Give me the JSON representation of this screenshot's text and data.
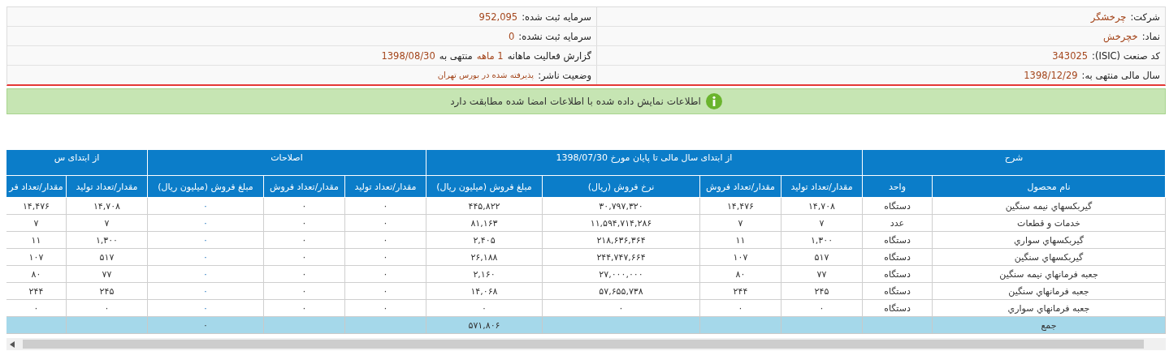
{
  "info": [
    {
      "cells": [
        {
          "kind": "field",
          "label": "شرکت:",
          "value": "چرخشگر"
        },
        {
          "kind": "field",
          "label": "سرمایه ثبت شده:",
          "value": "952,095"
        }
      ]
    },
    {
      "cells": [
        {
          "kind": "field",
          "label": "نماد:",
          "value": "خچرخش"
        },
        {
          "kind": "field",
          "label": "سرمایه ثبت نشده:",
          "value": "0"
        }
      ]
    },
    {
      "cells": [
        {
          "kind": "field",
          "label": "کد صنعت (ISIC):",
          "value": "343025"
        },
        {
          "kind": "report",
          "label": "گزارش فعالیت ماهانه",
          "period": "1 ماهه",
          "middle": "منتهی به",
          "value": "1398/08/30"
        }
      ]
    },
    {
      "cells": [
        {
          "kind": "field",
          "label": "سال مالی منتهی به:",
          "value": "1398/12/29"
        },
        {
          "kind": "status",
          "label": "وضعیت ناشر:",
          "value": "پذیرفته شده در بورس تهران"
        }
      ]
    }
  ],
  "banner": {
    "text": "اطلاعات نمایش داده شده با اطلاعات امضا شده مطابقت دارد"
  },
  "table": {
    "groups": [
      {
        "label": "شرح"
      },
      {
        "label": "از ابتدای سال مالی تا پایان مورخ 1398/07/30"
      },
      {
        "label": "اصلاحات"
      },
      {
        "label": "از ابتدای س"
      }
    ],
    "columns": [
      "نام محصول",
      "واحد",
      "مقدار/تعداد تولید",
      "مقدار/تعداد فروش",
      "نرخ فروش (ریال)",
      "مبلغ فروش (میلیون ریال)",
      "مقدار/تعداد تولید",
      "مقدار/تعداد فروش",
      "مبلغ فروش (میلیون ریال)",
      "مقدار/تعداد تولید",
      "مقدار/تعداد فر"
    ],
    "rows": [
      {
        "cells": [
          "گیربکسهاي نیمه سنگین",
          "دستگاه",
          "۱۴,۷۰۸",
          "۱۴,۴۷۶",
          "۳۰,۷۹۷,۳۲۰",
          "۴۴۵,۸۲۲",
          "۰",
          "۰",
          "۰",
          "۱۴,۷۰۸",
          "۱۴,۴۷۶"
        ]
      },
      {
        "cells": [
          "خدمات و قطعات",
          "عدد",
          "۷",
          "۷",
          "۱۱,۵۹۴,۷۱۴,۲۸۶",
          "۸۱,۱۶۳",
          "۰",
          "۰",
          "۰",
          "۷",
          "۷"
        ]
      },
      {
        "cells": [
          "گیربکسهاي سواري",
          "دستگاه",
          "۱,۳۰۰",
          "۱۱",
          "۲۱۸,۶۳۶,۳۶۴",
          "۲,۴۰۵",
          "۰",
          "۰",
          "۰",
          "۱,۳۰۰",
          "۱۱"
        ]
      },
      {
        "cells": [
          "گیربکسهاي سنگین",
          "دستگاه",
          "۵۱۷",
          "۱۰۷",
          "۲۴۴,۷۴۷,۶۶۴",
          "۲۶,۱۸۸",
          "۰",
          "۰",
          "۰",
          "۵۱۷",
          "۱۰۷"
        ]
      },
      {
        "cells": [
          "جعبه فرمانهاي نیمه سنگین",
          "دستگاه",
          "۷۷",
          "۸۰",
          "۲۷,۰۰۰,۰۰۰",
          "۲,۱۶۰",
          "۰",
          "۰",
          "۰",
          "۷۷",
          "۸۰"
        ]
      },
      {
        "cells": [
          "جعبه فرمانهاي سنگین",
          "دستگاه",
          "۲۴۵",
          "۲۴۴",
          "۵۷,۶۵۵,۷۳۸",
          "۱۴,۰۶۸",
          "۰",
          "۰",
          "۰",
          "۲۴۵",
          "۲۴۴"
        ]
      },
      {
        "cells": [
          "جعبه فرمانهاي سواري",
          "دستگاه",
          "۰",
          "۰",
          "۰",
          "۰",
          "۰",
          "۰",
          "۰",
          "۰",
          "۰"
        ]
      }
    ],
    "total": {
      "cells": [
        "جمع",
        null,
        null,
        null,
        null,
        "۵۷۱,۸۰۶",
        null,
        null,
        "۰",
        null,
        null
      ]
    }
  }
}
